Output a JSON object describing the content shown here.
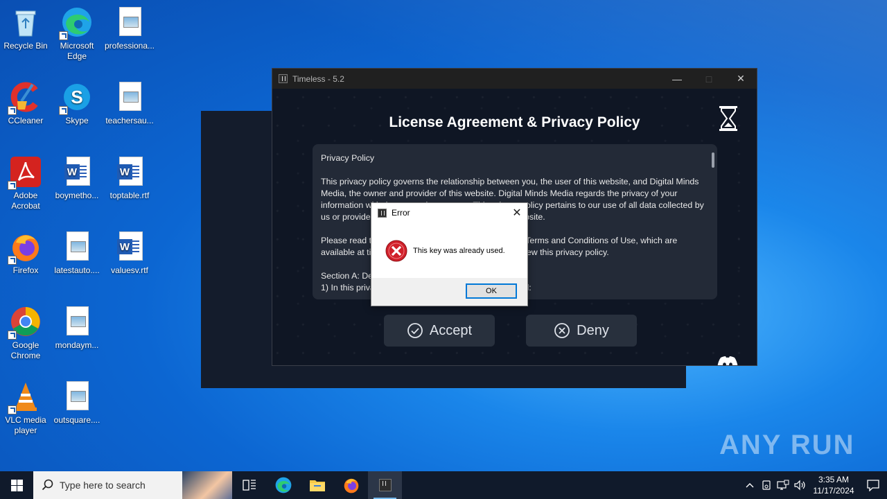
{
  "desktop": {
    "icons": [
      {
        "label": "Recycle Bin",
        "icon": "recycle-bin-icon"
      },
      {
        "label": "Microsoft Edge",
        "icon": "edge-icon"
      },
      {
        "label": "professiona...",
        "icon": "image-file-icon"
      },
      {
        "label": "CCleaner",
        "icon": "ccleaner-icon"
      },
      {
        "label": "Skype",
        "icon": "skype-icon"
      },
      {
        "label": "teachersau...",
        "icon": "image-file-icon"
      },
      {
        "label": "Adobe Acrobat",
        "icon": "acrobat-icon"
      },
      {
        "label": "boymetho...",
        "icon": "word-doc-icon"
      },
      {
        "label": "toptable.rtf",
        "icon": "word-doc-icon"
      },
      {
        "label": "Firefox",
        "icon": "firefox-icon"
      },
      {
        "label": "latestauto....",
        "icon": "image-file-icon"
      },
      {
        "label": "valuesv.rtf",
        "icon": "word-doc-icon"
      },
      {
        "label": "Google Chrome",
        "icon": "chrome-icon"
      },
      {
        "label": "mondaym...",
        "icon": "image-file-icon"
      },
      {
        "label": "VLC media player",
        "icon": "vlc-icon"
      },
      {
        "label": "outsquare....",
        "icon": "image-file-icon"
      }
    ]
  },
  "app": {
    "title": "Timeless - 5.2",
    "heading": "License Agreement &  Privacy Policy",
    "policy_title": "Privacy Policy",
    "policy_p1": "This privacy policy governs the relationship between you, the user of this website, and Digital Minds Media, the owner and provider of this website. Digital Minds Media regards the privacy of your information with the utmost importance. This privacy policy pertains to our use of all data collected by us or provided by you in relation to your use of the website.",
    "policy_p2": "Please read this privacy policy in conjunction with the Terms and Conditions of Use, which are available at timeless, and make sure you carefully review this privacy policy.",
    "policy_s1": "Section A: Definitions",
    "policy_s2": "1) In this privacy policy the following terms will be used:",
    "accept_label": "Accept",
    "deny_label": "Deny"
  },
  "error_dialog": {
    "title": "Error",
    "message": "This key was already used.",
    "ok_label": "OK"
  },
  "watermark": {
    "text": "ANY RUN"
  },
  "taskbar": {
    "search_placeholder": "Type here to search",
    "time": "3:35 AM",
    "date": "11/17/2024",
    "pinned": [
      "task-view-icon",
      "edge-icon",
      "file-explorer-icon",
      "firefox-icon",
      "timeless-app-icon"
    ]
  },
  "colors": {
    "desktop_accent": "#0c66d2",
    "app_bg": "#0f1624",
    "error_red": "#d0202a"
  }
}
